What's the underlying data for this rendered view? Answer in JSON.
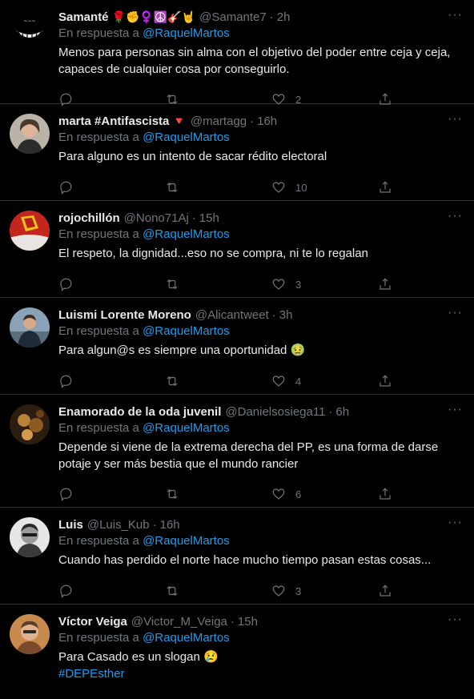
{
  "reply_prefix": "En respuesta a",
  "tweets": [
    {
      "name": "Samanté",
      "emoji": "🌹✊♀️☮️🎸🤘",
      "handle": "@Samante7",
      "time": "2h",
      "reply_to": "@RaquelMartos",
      "lines": [
        "Menos para personas sin alma con el objetivo del poder entre ceja y ceja,",
        "capaces de cualquier cosa por conseguirlo."
      ],
      "likes": "2"
    },
    {
      "name": "marta #Antifascista",
      "emoji": "🔻",
      "handle": "@martagg",
      "time": "16h",
      "reply_to": "@RaquelMartos",
      "lines": [
        "Para alguno es un intento de sacar rédito electoral"
      ],
      "likes": "10"
    },
    {
      "name": "rojochillón",
      "emoji": "",
      "handle": "@Nono71Aj",
      "time": "15h",
      "reply_to": "@RaquelMartos",
      "lines": [
        "El respeto, la dignidad...eso no se compra, ni te lo regalan"
      ],
      "likes": "3"
    },
    {
      "name": "Luismi Lorente Moreno",
      "emoji": "",
      "handle": "@Alicantweet",
      "time": "3h",
      "reply_to": "@RaquelMartos",
      "lines": [
        "Para algun@s es siempre una oportunidad 🤢"
      ],
      "likes": "4"
    },
    {
      "name": "Enamorado de la oda juvenil",
      "emoji": "",
      "handle": "@Danielsosiega11",
      "time": "6h",
      "reply_to": "@RaquelMartos",
      "lines": [
        "Depende si viene de la extrema derecha del PP, es una forma de darse",
        "potaje y ser más bestia que el mundo rancier"
      ],
      "likes": "6"
    },
    {
      "name": "Luis",
      "emoji": "",
      "handle": "@Luis_Kub",
      "time": "16h",
      "reply_to": "@RaquelMartos",
      "lines": [
        "Cuando has perdido el norte hace mucho tiempo pasan estas cosas..."
      ],
      "likes": "3"
    },
    {
      "name": "Víctor Veiga",
      "emoji": "",
      "handle": "@Victor_M_Veiga",
      "time": "15h",
      "reply_to": "@RaquelMartos",
      "lines": [
        "Para Casado es un slogan 😢"
      ],
      "hashtag": "#DEPEsther",
      "likes": ""
    }
  ],
  "colors": {
    "background": "#000000",
    "text": "#e7e9ea",
    "muted": "#71767b",
    "accent": "#1d9bf0",
    "divider": "#2f3336"
  }
}
